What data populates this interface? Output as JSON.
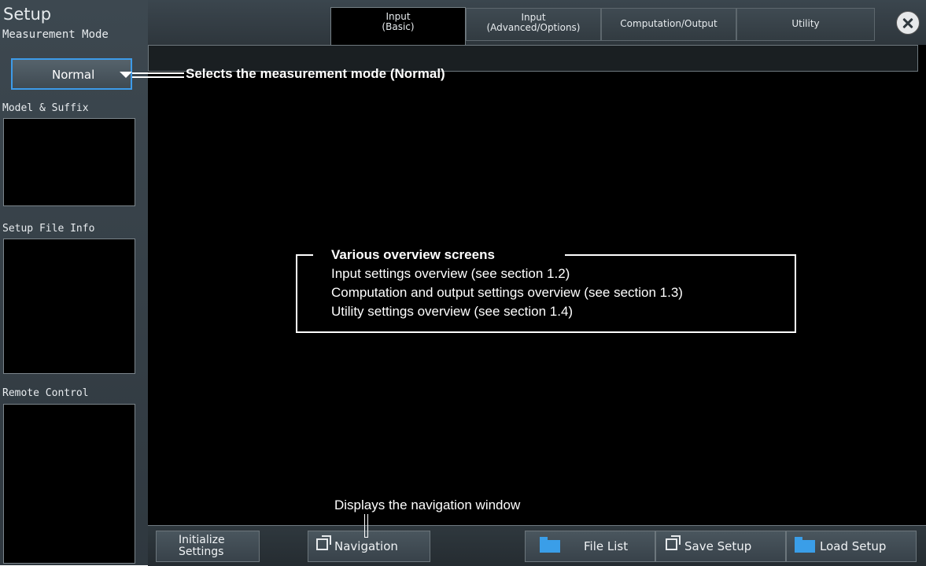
{
  "window": {
    "title": "Setup"
  },
  "left_panel": {
    "measurement_mode_label": "Measurement Mode",
    "measurement_mode_value": "Normal",
    "model_suffix_label": "Model & Suffix",
    "setup_file_info_label": "Setup File Info",
    "remote_control_label": "Remote Control"
  },
  "tabs": [
    {
      "line1": "Input",
      "line2": "(Basic)",
      "active": true
    },
    {
      "line1": "Input",
      "line2": "(Advanced/Options)",
      "active": false
    },
    {
      "line1": "Computation/Output",
      "line2": "",
      "active": false
    },
    {
      "line1": "Utility",
      "line2": "",
      "active": false
    }
  ],
  "bottom_buttons": {
    "initialize_line1": "Initialize",
    "initialize_line2": "Settings",
    "navigation": "Navigation",
    "file_list": "File List",
    "save_setup": "Save Setup",
    "load_setup": "Load Setup"
  },
  "annotations": {
    "mode_callout": "Selects the measurement mode (Normal)",
    "overview_title": "Various overview screens",
    "overview_lines": [
      "Input settings overview (see section 1.2)",
      "Computation and output settings overview (see section 1.3)",
      "Utility settings overview (see section 1.4)"
    ],
    "navigation_callout": "Displays the navigation window"
  },
  "colors": {
    "accent": "#3d9be9",
    "folder": "#3a9ee8",
    "background": "#000000"
  },
  "icons": [
    "close-icon",
    "dropdown-caret-icon",
    "external-link-icon",
    "folder-icon"
  ]
}
